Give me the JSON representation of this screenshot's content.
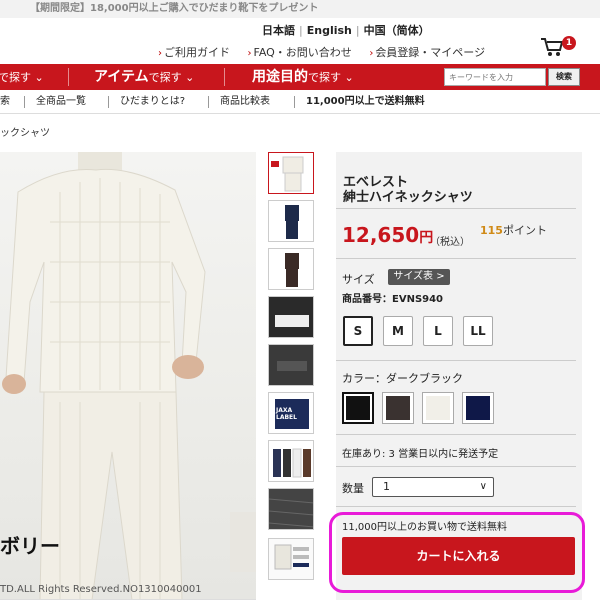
{
  "promo": {
    "text": "【期間限定】18,000円以上ご購入でひだまり靴下をプレゼント"
  },
  "languages": [
    "日本語",
    "English",
    "中国（简体）"
  ],
  "util_nav": [
    "ご利用ガイド",
    "FAQ・お問い合わせ",
    "会員登録・マイページ"
  ],
  "cart": {
    "count": "1"
  },
  "main_nav": [
    {
      "strong": "",
      "rest": "で探す ⌄"
    },
    {
      "strong": "アイテム",
      "rest": "で探す ⌄"
    },
    {
      "strong": "用途目的",
      "rest": "で探す ⌄"
    }
  ],
  "search": {
    "placeholder": "キーワードを入力",
    "button": "検索"
  },
  "sub_nav": [
    "索",
    "全商品一覧",
    "ひだまりとは?",
    "商品比較表",
    "11,000円以上で送料無料"
  ],
  "breadcrumb": "ックシャツ",
  "photo": {
    "caption": "ボリー",
    "copyright": "TD.ALL Rights Reserved.NO1310040001"
  },
  "thumb_labels": {
    "jaxa": "JAXA LABEL"
  },
  "product": {
    "title_line1": "エベレスト",
    "title_line2": "紳士ハイネックシャツ",
    "price": "12,650",
    "price_unit": "円",
    "tax": "（税込）",
    "points_value": "115",
    "points_label": "ポイント",
    "size_label": "サイズ",
    "size_chart": "サイズ表 >",
    "sku_label": "商品番号：",
    "sku": "EVNS940",
    "sizes": [
      "S",
      "M",
      "L",
      "LL"
    ],
    "selected_size": "S",
    "color_label": "カラー：ダークブラック",
    "colors": [
      {
        "name": "black",
        "hex": "#111111"
      },
      {
        "name": "dark-brown",
        "hex": "#3a3230"
      },
      {
        "name": "ivory",
        "hex": "#f1efe8"
      },
      {
        "name": "navy",
        "hex": "#0f1848"
      }
    ],
    "stock": "在庫あり: 3 営業日以内に発送予定",
    "qty_label": "数量",
    "qty_value": "1",
    "free_shipping": "11,000円以上のお買い物で送料無料",
    "add_to_cart": "カートに入れる"
  },
  "colors": {
    "brand_red": "#c8161d",
    "points_orange": "#d08a17",
    "highlight_magenta": "#e81ad8"
  }
}
